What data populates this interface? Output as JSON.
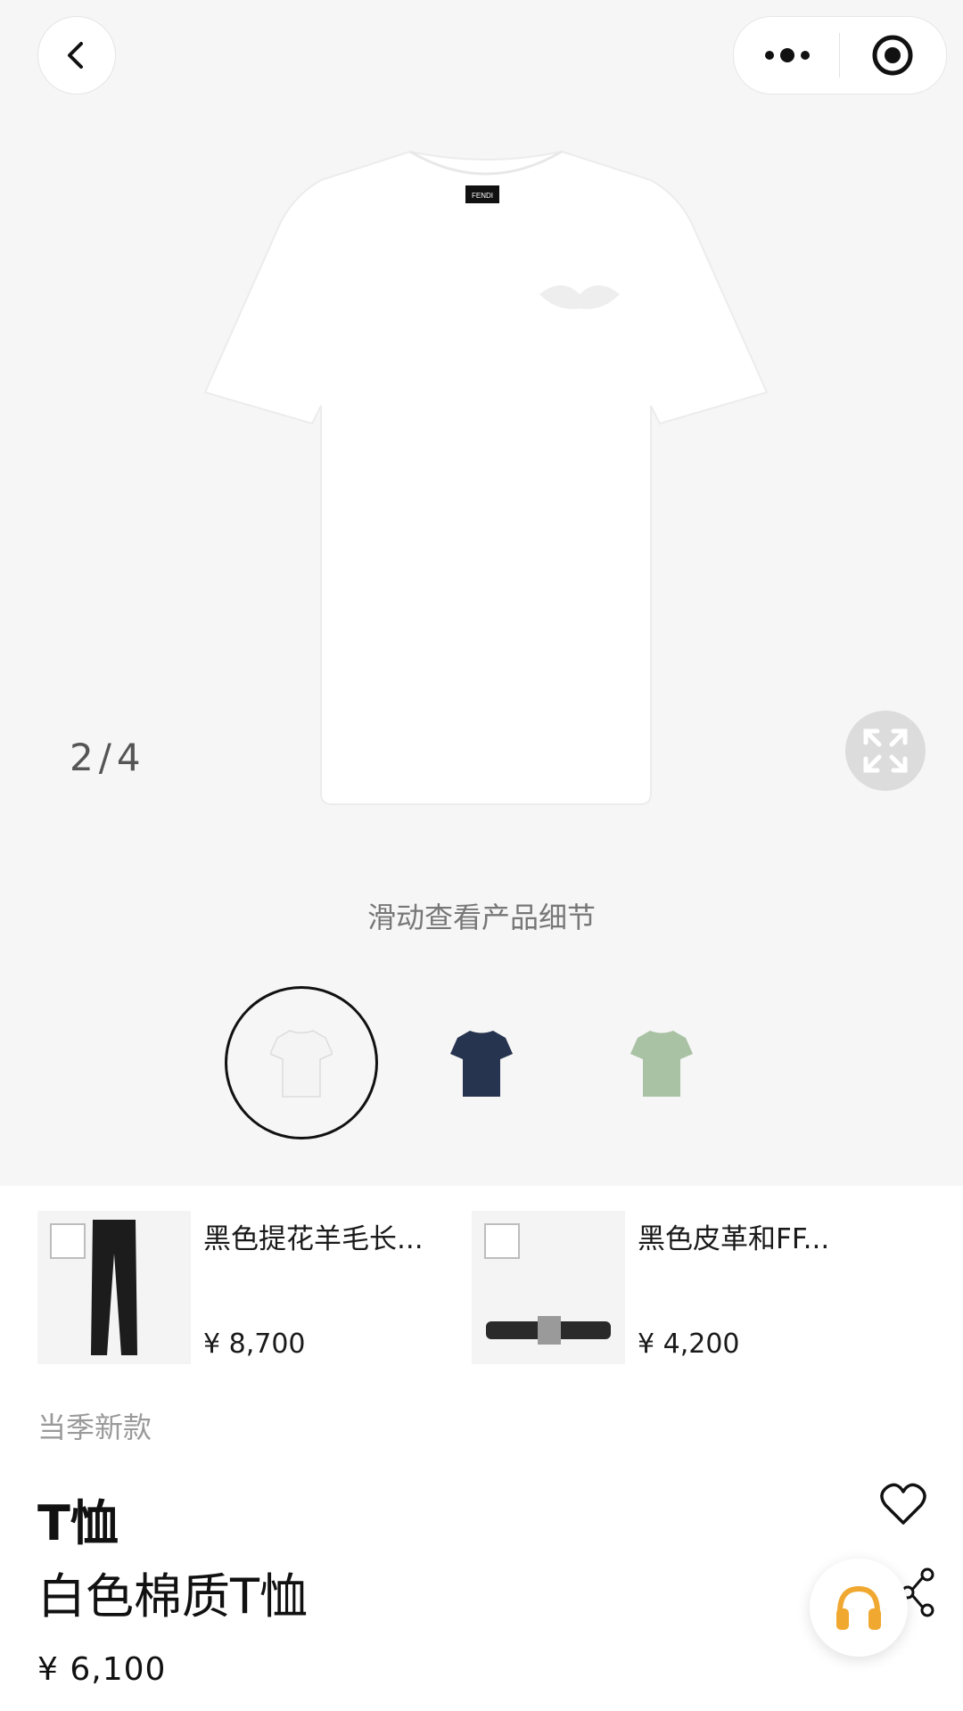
{
  "gallery": {
    "counter": "2/4",
    "hint": "滑动查看产品细节",
    "label_text": "FENDI"
  },
  "variants": [
    {
      "color": "white",
      "hex": "#f4f4f4",
      "selected": true
    },
    {
      "color": "navy",
      "hex": "#27344f",
      "selected": false
    },
    {
      "color": "sage green",
      "hex": "#a9c2a4",
      "selected": false
    }
  ],
  "related": [
    {
      "name": "黑色提花羊毛长...",
      "price": "¥ 8,700"
    },
    {
      "name": "黑色皮革和FF...",
      "price": "¥ 4,200"
    }
  ],
  "product": {
    "season_tag": "当季新款",
    "category": "T恤",
    "title": "白色棉质T恤",
    "price": "¥ 6,100"
  },
  "icons": {
    "back": "chevron-left-icon",
    "more": "more-dots-icon",
    "close": "target-circle-icon",
    "expand": "expand-arrows-icon",
    "favorite": "heart-icon",
    "share": "share-icon",
    "service": "headphones-icon"
  },
  "colors": {
    "service_icon": "#f0a830"
  }
}
